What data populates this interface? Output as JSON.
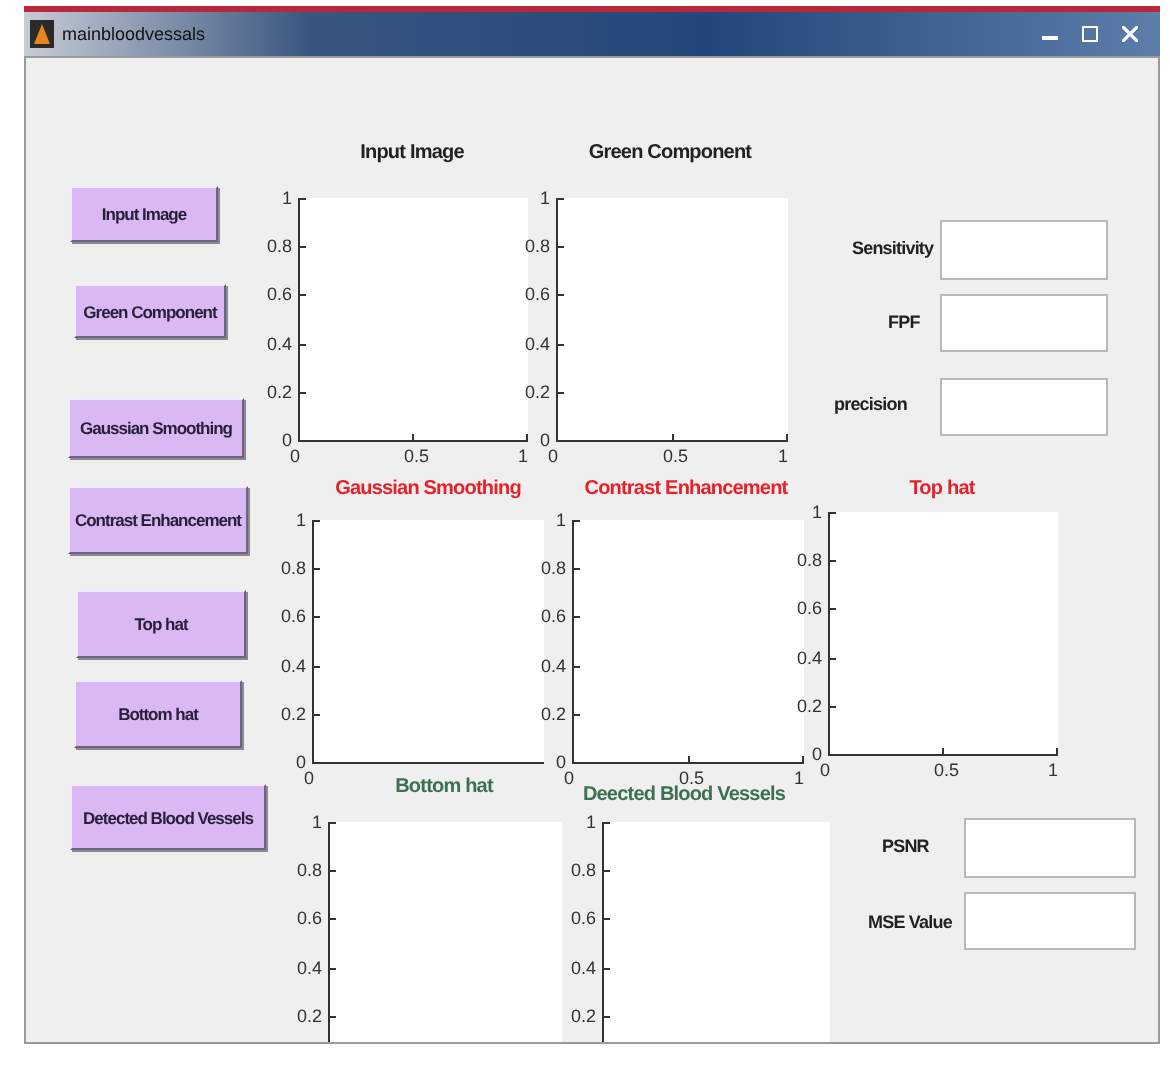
{
  "window": {
    "title": "mainbloodvessals"
  },
  "buttons": [
    "Input Image",
    "Green Component",
    "Gaussian Smoothing",
    "Contrast Enhancement",
    "Top hat",
    "Bottom hat",
    "Detected Blood Vessels"
  ],
  "axes": [
    {
      "title": "Input Image",
      "color": "#222222",
      "yticks": [
        "1",
        "0.8",
        "0.6",
        "0.4",
        "0.2",
        "0"
      ],
      "xticks": [
        "0",
        "0.5",
        "1"
      ]
    },
    {
      "title": "Green Component",
      "color": "#222222",
      "yticks": [
        "1",
        "0.8",
        "0.6",
        "0.4",
        "0.2",
        "0"
      ],
      "xticks": [
        "0",
        "0.5",
        "1"
      ]
    },
    {
      "title": "Gaussian Smoothing",
      "color": "#e8202a",
      "yticks": [
        "1",
        "0.8",
        "0.6",
        "0.4",
        "0.2",
        "0"
      ],
      "xticks": [
        "0"
      ]
    },
    {
      "title": "Contrast Enhancement",
      "color": "#e8202a",
      "yticks": [
        "1",
        "0.8",
        "0.6",
        "0.4",
        "0.2",
        "0"
      ],
      "xticks": [
        "0",
        "0.5",
        "1"
      ]
    },
    {
      "title": "Top hat",
      "color": "#e8202a",
      "yticks": [
        "1",
        "0.8",
        "0.6",
        "0.4",
        "0.2",
        "0"
      ],
      "xticks": [
        "0",
        "0.5",
        "1"
      ]
    },
    {
      "title": "Bottom hat",
      "color": "#3c7050",
      "yticks": [
        "1",
        "0.8",
        "0.6",
        "0.4",
        "0.2"
      ]
    },
    {
      "title": "Deected Blood Vessels",
      "color": "#3c7050",
      "yticks": [
        "1",
        "0.8",
        "0.6",
        "0.4",
        "0.2"
      ]
    }
  ],
  "fields": [
    {
      "label": "Sensitivity"
    },
    {
      "label": "FPF"
    },
    {
      "label": "precision"
    },
    {
      "label": "PSNR"
    },
    {
      "label": "MSE Value"
    }
  ]
}
